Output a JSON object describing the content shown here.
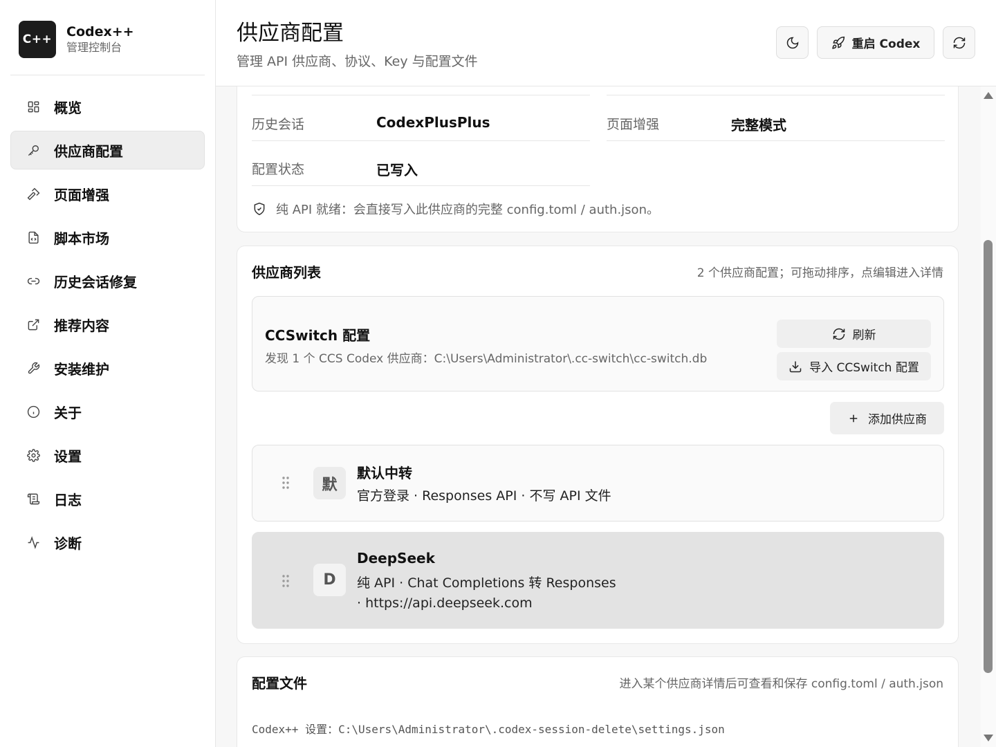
{
  "brand": {
    "logo": "C++",
    "name": "Codex++",
    "subtitle": "管理控制台"
  },
  "sidebar": {
    "items": [
      {
        "label": "概览",
        "icon": "grid-icon"
      },
      {
        "label": "供应商配置",
        "icon": "key-icon",
        "active": true
      },
      {
        "label": "页面增强",
        "icon": "hammer-icon"
      },
      {
        "label": "脚本市场",
        "icon": "file-code-icon"
      },
      {
        "label": "历史会话修复",
        "icon": "link-icon"
      },
      {
        "label": "推荐内容",
        "icon": "external-link-icon"
      },
      {
        "label": "安装维护",
        "icon": "wrench-icon"
      },
      {
        "label": "关于",
        "icon": "info-icon"
      },
      {
        "label": "设置",
        "icon": "gear-icon"
      },
      {
        "label": "日志",
        "icon": "scroll-icon"
      },
      {
        "label": "诊断",
        "icon": "activity-icon"
      }
    ]
  },
  "header": {
    "title": "供应商配置",
    "subtitle": "管理 API 供应商、协议、Key 与配置文件",
    "restart_label": "重启 Codex"
  },
  "status_card": {
    "history_key": "历史会话",
    "history_val": "CodexPlusPlus",
    "enhance_key": "页面增强",
    "enhance_val": "完整模式",
    "config_key": "配置状态",
    "config_val": "已写入",
    "note": "纯 API 就绪：会直接写入此供应商的完整 config.toml / auth.json。"
  },
  "provider_list": {
    "title": "供应商列表",
    "meta": "2 个供应商配置；可拖动排序，点编辑进入详情",
    "ccswitch": {
      "title": "CCSwitch 配置",
      "desc": "发现 1 个 CCS Codex 供应商：C:\\Users\\Administrator\\.cc-switch\\cc-switch.db",
      "refresh_label": "刷新",
      "import_label": "导入 CCSwitch 配置"
    },
    "add_label": "添加供应商",
    "providers": [
      {
        "avatar": "默",
        "name": "默认中转",
        "desc": "官方登录 · Responses API · 不写 API 文件"
      },
      {
        "avatar": "D",
        "name": "DeepSeek",
        "desc": "纯 API · Chat Completions 转 Responses · https://api.deepseek.com"
      }
    ]
  },
  "config_files": {
    "title": "配置文件",
    "meta": "进入某个供应商详情后可查看和保存 config.toml / auth.json",
    "settings_path": "Codex++ 设置：C:\\Users\\Administrator\\.codex-session-delete\\settings.json"
  }
}
